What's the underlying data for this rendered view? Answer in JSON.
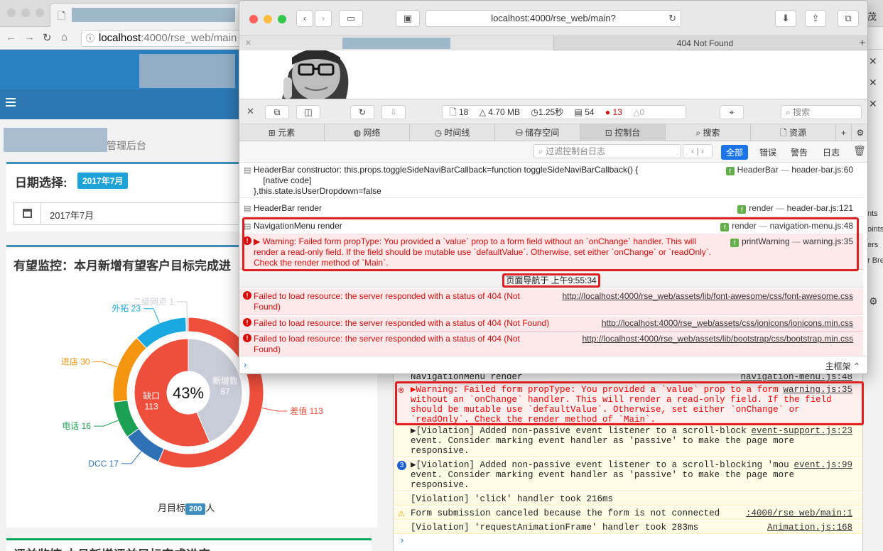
{
  "chrome": {
    "address": {
      "host": "localhost",
      "path": ":4000/rse_web/main"
    },
    "page": {
      "breadcrumb_suffix": "管理后台",
      "panel_date": {
        "title": "日期选择:",
        "badge": "2017年7月",
        "date_value": "2017年7月"
      },
      "panel_monitor": {
        "title": "有望监控：本月新增有望客户目标完成进"
      },
      "panel_bottom": {
        "title": "评益监控 本月新增评益目标完成进度"
      },
      "goal": {
        "prefix": "月目标",
        "value": "200",
        "suffix": "人"
      }
    },
    "devtools": {
      "lines": [
        {
          "text": "NavigationMenu render",
          "src": "navigation-menu.js:48",
          "kind": "log"
        },
        {
          "text": "▶Warning: Failed form propType: You provided a `value` prop to a form field without an `onChange` handler. This will render a read-only field. If the field should be mutable use `defaultValue`. Otherwise, set either `onChange` or `readOnly`. Check the render method of `Main`.",
          "src": "warning.js:35",
          "kind": "error"
        },
        {
          "text": "▶[Violation] Added non-passive event listener to a scroll-blocking 'touchstart' event. Consider marking event handler as 'passive' to make the page more responsive.",
          "src": "event-support.js:23",
          "kind": "warn"
        },
        {
          "text": "▶[Violation] Added non-passive event listener to a scroll-blocking 'mousewheel' event. Consider marking event handler as 'passive' to make the page more responsive.",
          "src": "event.js:99",
          "kind": "warn",
          "count": "3"
        },
        {
          "text": "[Violation] 'click' handler took 216ms",
          "src": "",
          "kind": "warn"
        },
        {
          "text": "Form submission canceled because the form is not connected",
          "src": ":4000/rse_web/main:1",
          "kind": "warn",
          "icon": "⚠"
        },
        {
          "text": "[Violation] 'requestAnimationFrame' handler took 283ms",
          "src": "Animation.js:168",
          "kind": "warn"
        }
      ]
    },
    "right_strip": {
      "top_text": "茂",
      "items": [
        "nts",
        "oints",
        "ers",
        "r Bre"
      ]
    }
  },
  "chart_data": {
    "type": "pie",
    "center_label": "43%",
    "inner_ring": [
      {
        "name": "新增数",
        "value": 87,
        "color": "#c8ccd6"
      },
      {
        "name": "缺口",
        "value": 113,
        "color": "#ef4e3c"
      }
    ],
    "outer_ring": [
      {
        "name": "差值",
        "value": 113,
        "color": "#ef4e3c"
      },
      {
        "name": "DCC",
        "value": 17,
        "color": "#2e72b5"
      },
      {
        "name": "电话",
        "value": 16,
        "color": "#1aa050"
      },
      {
        "name": "进店",
        "value": 30,
        "color": "#f3950f"
      },
      {
        "name": "外拓",
        "value": 23,
        "color": "#1aa8e0"
      },
      {
        "name": "二级网点",
        "value": 1,
        "color": "#c8ccd6"
      }
    ]
  },
  "safari": {
    "url": "localhost:4000/rse_web/main?",
    "tab2_title": "404 Not Found",
    "stats": {
      "resources": "18",
      "size": "4.70 MB",
      "time": "1.25秒",
      "logs": "54",
      "errors": "13",
      "warnings": "0"
    },
    "search_placeholder": "搜索",
    "tabs": [
      "元素",
      "网络",
      "时间线",
      "储存空间",
      "控制台",
      "搜索",
      "资源"
    ],
    "filter_placeholder": "过滤控制台日志",
    "filter_buttons": [
      "全部",
      "错误",
      "警告",
      "日志"
    ],
    "frame_label": "主框架 ⌃",
    "nav_time": "页面导航于 上午9:55:34",
    "console": [
      {
        "text": "HeaderBar constructor: this.props.toggleSideNaviBarCallback=function toggleSideNaviBarCallback() {",
        "text2": "    [native code]",
        "text3": "},this.state.isUserDropdown=false",
        "fn": "HeaderBar",
        "src": "header-bar.js:60"
      },
      {
        "text": "HeaderBar render",
        "fn": "render",
        "src": "header-bar.js:121"
      },
      {
        "text": "NavigationMenu render",
        "fn": "render",
        "src": "navigation-menu.js:48"
      },
      {
        "text": "▶ Warning: Failed form propType: You provided a `value` prop to a form field without an `onChange` handler. This will render a read-only field. If the field should be mutable use `defaultValue`. Otherwise, set either `onChange` or `readOnly`. Check the render method of `Main`.",
        "fn": "printWarning",
        "src": "warning.js:35"
      },
      {
        "text": "Failed to load resource: the server responded with a status of 404 (Not Found)",
        "src": "http://localhost:4000/rse_web/assets/lib/font-awesome/css/font-awesome.css"
      },
      {
        "text": "Failed to load resource: the server responded with a status of 404 (Not Found)",
        "src": "http://localhost:4000/rse_web/assets/css/ionicons/ionicons.min.css"
      },
      {
        "text": "Failed to load resource: the server responded with a status of 404 (Not Found)",
        "src": "http://localhost:4000/rse_web/assets/lib/bootstrap/css/bootstrap.min.css"
      }
    ]
  }
}
